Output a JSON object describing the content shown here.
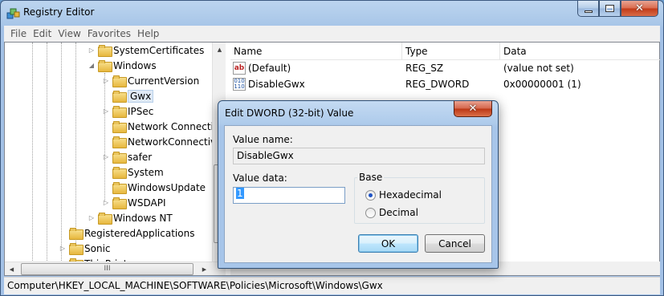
{
  "window": {
    "title": "Registry Editor"
  },
  "menu": [
    "File",
    "Edit",
    "View",
    "Favorites",
    "Help"
  ],
  "tree": [
    {
      "label": "SystemCertificates",
      "expander": "▷"
    },
    {
      "label": "Windows",
      "expander": "◢"
    },
    {
      "label": "CurrentVersion",
      "expander": "▷"
    },
    {
      "label": "Gwx",
      "expander": ""
    },
    {
      "label": "IPSec",
      "expander": "▷"
    },
    {
      "label": "Network Connectio",
      "expander": ""
    },
    {
      "label": "NetworkConnectivi",
      "expander": ""
    },
    {
      "label": "safer",
      "expander": "▷"
    },
    {
      "label": "System",
      "expander": ""
    },
    {
      "label": "WindowsUpdate",
      "expander": ""
    },
    {
      "label": "WSDAPI",
      "expander": "▷"
    },
    {
      "label": "Windows NT",
      "expander": "▷"
    },
    {
      "label": "RegisteredApplications",
      "expander": ""
    },
    {
      "label": "Sonic",
      "expander": "▷"
    },
    {
      "label": "ThinPrint",
      "expander": "▷"
    }
  ],
  "list": {
    "columns": [
      "Name",
      "Type",
      "Data"
    ],
    "rows": [
      {
        "icon": "string-value-icon",
        "name": "(Default)",
        "type": "REG_SZ",
        "data": "(value not set)"
      },
      {
        "icon": "binary-value-icon",
        "name": "DisableGwx",
        "type": "REG_DWORD",
        "data": "0x00000001 (1)"
      }
    ]
  },
  "status": "Computer\\HKEY_LOCAL_MACHINE\\SOFTWARE\\Policies\\Microsoft\\Windows\\Gwx",
  "dialog": {
    "title": "Edit DWORD (32-bit) Value",
    "value_name_label": "Value name:",
    "value_name": "DisableGwx",
    "value_data_label": "Value data:",
    "value_data": "1",
    "base_label": "Base",
    "hex_label": "Hexadecimal",
    "dec_label": "Decimal",
    "base_selected": "Hexadecimal",
    "ok": "OK",
    "cancel": "Cancel"
  },
  "scroll_grip": "III",
  "vscroll_grip": "≡"
}
